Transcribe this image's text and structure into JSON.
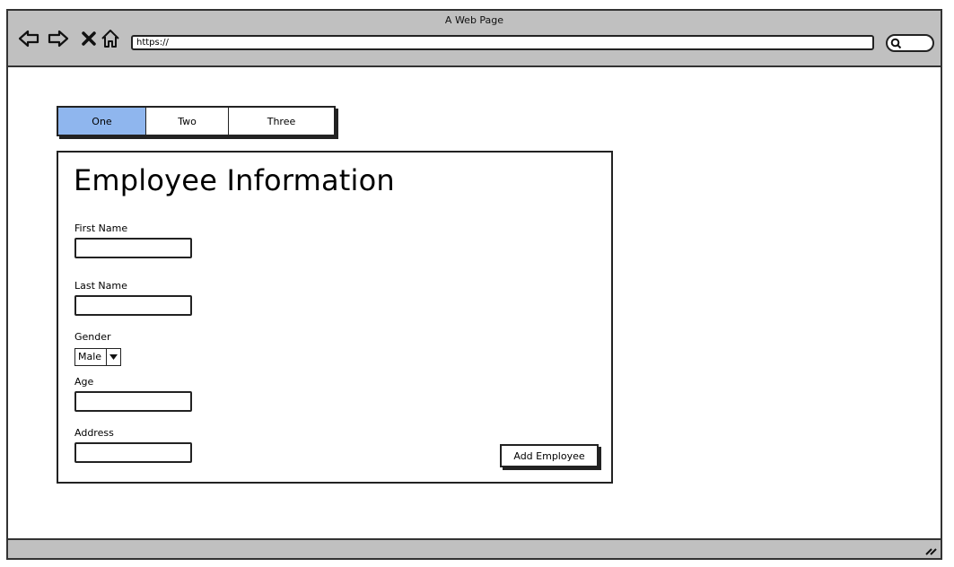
{
  "browser": {
    "title": "A Web Page",
    "url": "https://"
  },
  "tabs": [
    {
      "label": "One",
      "active": true
    },
    {
      "label": "Two",
      "active": false
    },
    {
      "label": "Three",
      "active": false
    }
  ],
  "form": {
    "heading": "Employee Information",
    "fields": {
      "first_name": {
        "label": "First Name",
        "value": ""
      },
      "last_name": {
        "label": "Last Name",
        "value": ""
      },
      "gender": {
        "label": "Gender",
        "value": "Male"
      },
      "age": {
        "label": "Age",
        "value": ""
      },
      "address": {
        "label": "Address",
        "value": ""
      }
    },
    "submit_label": "Add Employee"
  },
  "colors": {
    "active_tab": "#8fb6ee",
    "chrome": "#c0c0c0"
  }
}
